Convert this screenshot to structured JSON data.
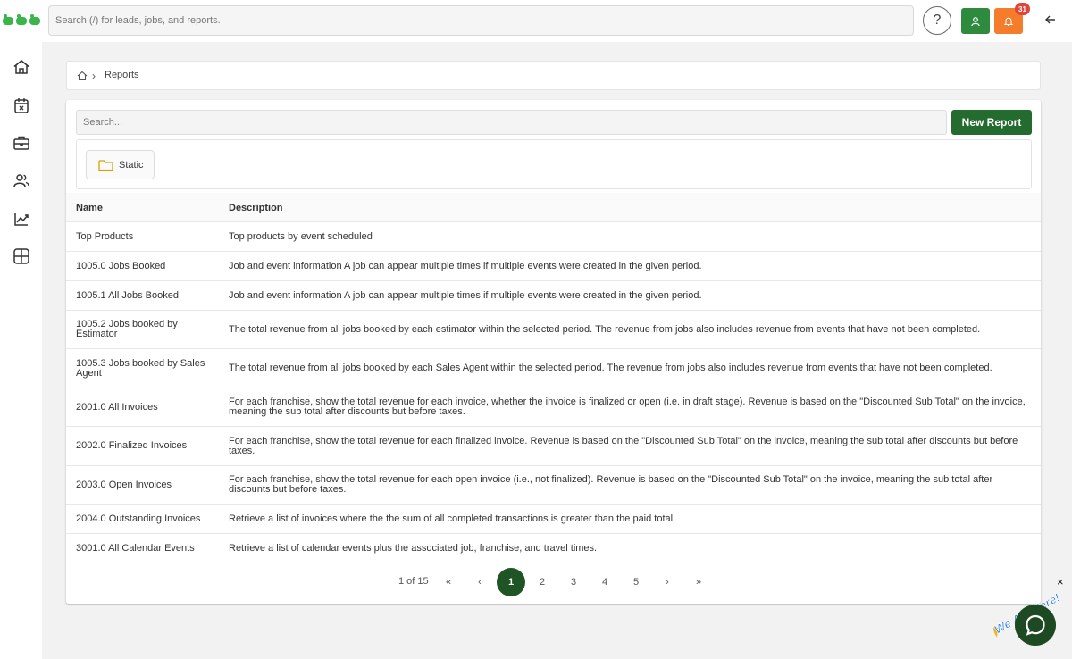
{
  "header": {
    "search_placeholder": "Search (/) for leads, jobs, and reports.",
    "help_label": "?",
    "notification_count": "31"
  },
  "sidebar": {
    "items": [
      {
        "icon": "home-icon"
      },
      {
        "icon": "calendar-icon"
      },
      {
        "icon": "briefcase-icon"
      },
      {
        "icon": "users-icon"
      },
      {
        "icon": "chart-icon"
      },
      {
        "icon": "grid-icon"
      }
    ]
  },
  "breadcrumb": {
    "current": "Reports"
  },
  "reports": {
    "search_placeholder": "Search...",
    "new_report_label": "New Report",
    "folder_label": "Static",
    "columns": {
      "name": "Name",
      "description": "Description"
    },
    "rows": [
      {
        "name": "Top Products",
        "description": "Top products by event scheduled"
      },
      {
        "name": "1005.0 Jobs Booked",
        "description": "Job and event information A job can appear multiple times if multiple events were created in the given period."
      },
      {
        "name": "1005.1 All Jobs Booked",
        "description": "Job and event information A job can appear multiple times if multiple events were created in the given period."
      },
      {
        "name": "1005.2 Jobs booked by Estimator",
        "description": "The total revenue from all jobs booked by each estimator within the selected period. The revenue from jobs also includes revenue from events that have not been completed."
      },
      {
        "name": "1005.3 Jobs booked by Sales Agent",
        "description": "The total revenue from all jobs booked by each Sales Agent within the selected period. The revenue from jobs also includes revenue from events that have not been completed."
      },
      {
        "name": "2001.0 All Invoices",
        "description": "For each franchise, show the total revenue for each invoice, whether the invoice is finalized or open (i.e. in draft stage). Revenue is based on the \"Discounted Sub Total\" on the invoice, meaning the sub total after discounts but before taxes."
      },
      {
        "name": "2002.0 Finalized Invoices",
        "description": "For each franchise, show the total revenue for each finalized invoice. Revenue is based on the \"Discounted Sub Total\" on the invoice, meaning the sub total after discounts but before taxes."
      },
      {
        "name": "2003.0 Open Invoices",
        "description": "For each franchise, show the total revenue for each open invoice (i.e., not finalized). Revenue is based on the \"Discounted Sub Total\" on the invoice, meaning the sub total after discounts but before taxes."
      },
      {
        "name": "2004.0 Outstanding Invoices",
        "description": "Retrieve a list of invoices where the the sum of all completed transactions is greater than the paid total."
      },
      {
        "name": "3001.0 All Calendar Events",
        "description": "Retrieve a list of calendar events plus the associated job, franchise, and travel times."
      }
    ]
  },
  "pagination": {
    "info": "1 of 15",
    "first": "«",
    "prev": "‹",
    "pages": [
      "1",
      "2",
      "3",
      "4",
      "5"
    ],
    "next": "›",
    "last": "»",
    "current": "1"
  },
  "chat": {
    "label": "We Are Here!",
    "close": "×"
  },
  "colors": {
    "primary_green": "#246b2f",
    "active_page": "#1f5424",
    "user_button": "#2e8b3d",
    "bell_button": "#f47c2a",
    "badge": "#e0453a"
  }
}
